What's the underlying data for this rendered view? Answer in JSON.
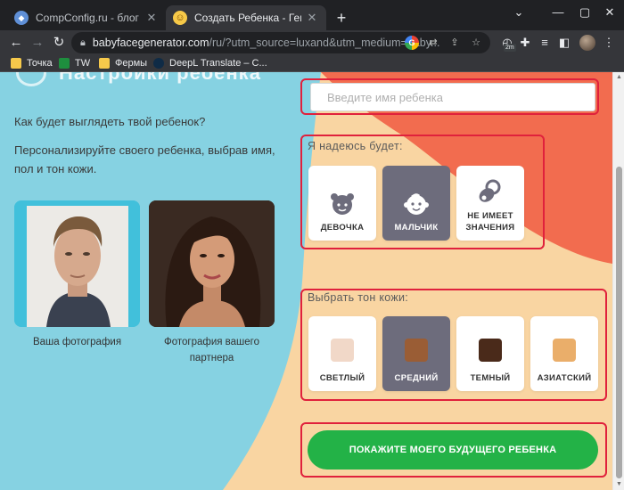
{
  "browser": {
    "tabs": [
      {
        "title": "CompConfig.ru - блог о настрой",
        "active": false
      },
      {
        "title": "Создать Ребенка - Генератор Ли",
        "active": true
      }
    ],
    "url_host": "babyfacegenerator.com",
    "url_rest": "/ru/?utm_source=luxand&utm_medium=baby...",
    "extension_badge": "2m",
    "bookmarks": [
      {
        "label": "Точка",
        "icon": "folder-icon"
      },
      {
        "label": "TW",
        "icon": "green-square-icon"
      },
      {
        "label": "Фермы",
        "icon": "folder-icon"
      },
      {
        "label": "DeepL Translate – С...",
        "icon": "deepl-icon"
      }
    ]
  },
  "page": {
    "heading_partial": "Настройки ребенка",
    "question": "Как будет выглядеть твой ребенок?",
    "description": "Персонализируйте своего ребенка, выбрав имя, пол и тон кожи.",
    "photos": [
      {
        "caption": "Ваша фотография"
      },
      {
        "caption": "Фотография вашего партнера"
      }
    ],
    "name_input": {
      "placeholder": "Введите имя ребенка",
      "value": ""
    },
    "gender": {
      "label": "Я надеюсь будет:",
      "options": [
        {
          "label": "ДЕВОЧКА",
          "icon": "girl-icon"
        },
        {
          "label": "МАЛЬЧИК",
          "icon": "boy-icon"
        },
        {
          "label": "НЕ ИМЕЕТ ЗНАЧЕНИЯ",
          "icon": "pacifier-icon"
        }
      ],
      "selected": "МАЛЬЧИК"
    },
    "skin_tone": {
      "label": "Выбрать тон кожи:",
      "options": [
        {
          "label": "СВЕТЛЫЙ",
          "color": "#f1d8c8"
        },
        {
          "label": "СРЕДНИЙ",
          "color": "#9a5d35"
        },
        {
          "label": "ТЕМНЫЙ",
          "color": "#4a2a1a"
        },
        {
          "label": "АЗИАТСКИЙ",
          "color": "#eaae6a"
        }
      ],
      "selected": "СРЕДНИЙ"
    },
    "cta": "ПОКАЖИТЕ МОЕГО БУДУЩЕГО РЕБЕНКА",
    "highlight_color": "#e0213c",
    "accent_green": "#23b247"
  }
}
